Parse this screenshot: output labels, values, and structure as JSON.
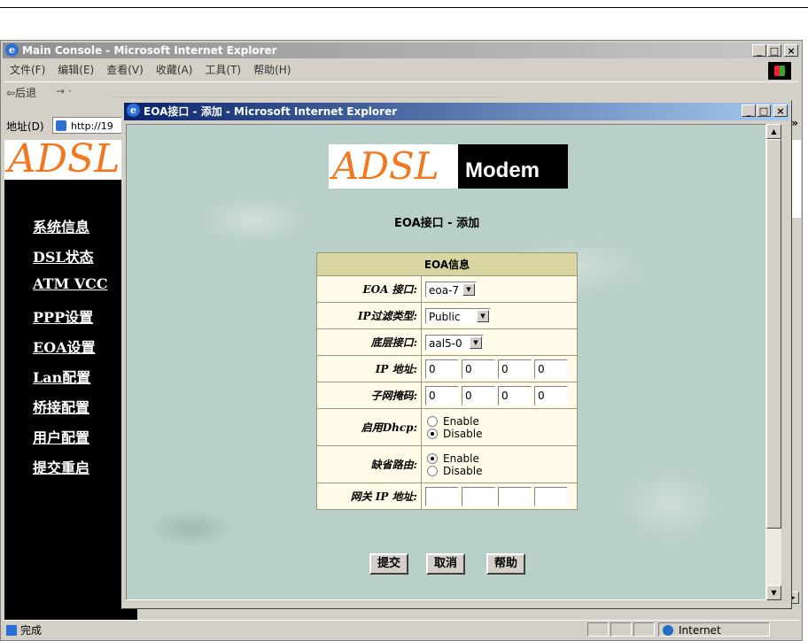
{
  "main_window": {
    "title": "Main Console - Microsoft Internet Explorer",
    "menu": [
      "文件(F)",
      "编辑(E)",
      "查看(V)",
      "收藏(A)",
      "工具(T)",
      "帮助(H)"
    ],
    "back_label": "⇦后退",
    "address_label": "地址(D)",
    "address_value": "http://19",
    "banner_logo": "ADSL",
    "nav": [
      "系统信息",
      "DSL状态",
      "ATM VCC",
      "PPP设置",
      "EOA设置",
      "Lan配置",
      "桥接配置",
      "用户配置",
      "提交重启"
    ],
    "status": "完成",
    "zone": "Internet"
  },
  "popup": {
    "title": "EOA接口 - 添加 - Microsoft Internet Explorer",
    "brand_adsl": "ADSL",
    "brand_modem": "Modem",
    "page_title": "EOA接口 - 添加",
    "table_header": "EOA信息",
    "fields": {
      "eoa_interface": {
        "label": "EOA 接口:",
        "value": "eoa-7"
      },
      "ip_filter": {
        "label": "IP过滤类型:",
        "value": "Public"
      },
      "lower_interface": {
        "label": "底层接口:",
        "value": "aal5-0"
      },
      "ip_address": {
        "label": "IP 地址:",
        "octets": [
          "0",
          "0",
          "0",
          "0"
        ]
      },
      "subnet_mask": {
        "label": "子网掩码:",
        "octets": [
          "0",
          "0",
          "0",
          "0"
        ]
      },
      "dhcp": {
        "label": "启用Dhcp:",
        "options": [
          "Enable",
          "Disable"
        ],
        "selected": "Disable"
      },
      "default_route": {
        "label": "缺省路由:",
        "options": [
          "Enable",
          "Disable"
        ],
        "selected": "Enable"
      },
      "gateway": {
        "label": "网关 IP 地址:",
        "octets": [
          "",
          "",
          "",
          ""
        ]
      }
    },
    "buttons": {
      "submit": "提交",
      "cancel": "取消",
      "help": "帮助"
    }
  }
}
